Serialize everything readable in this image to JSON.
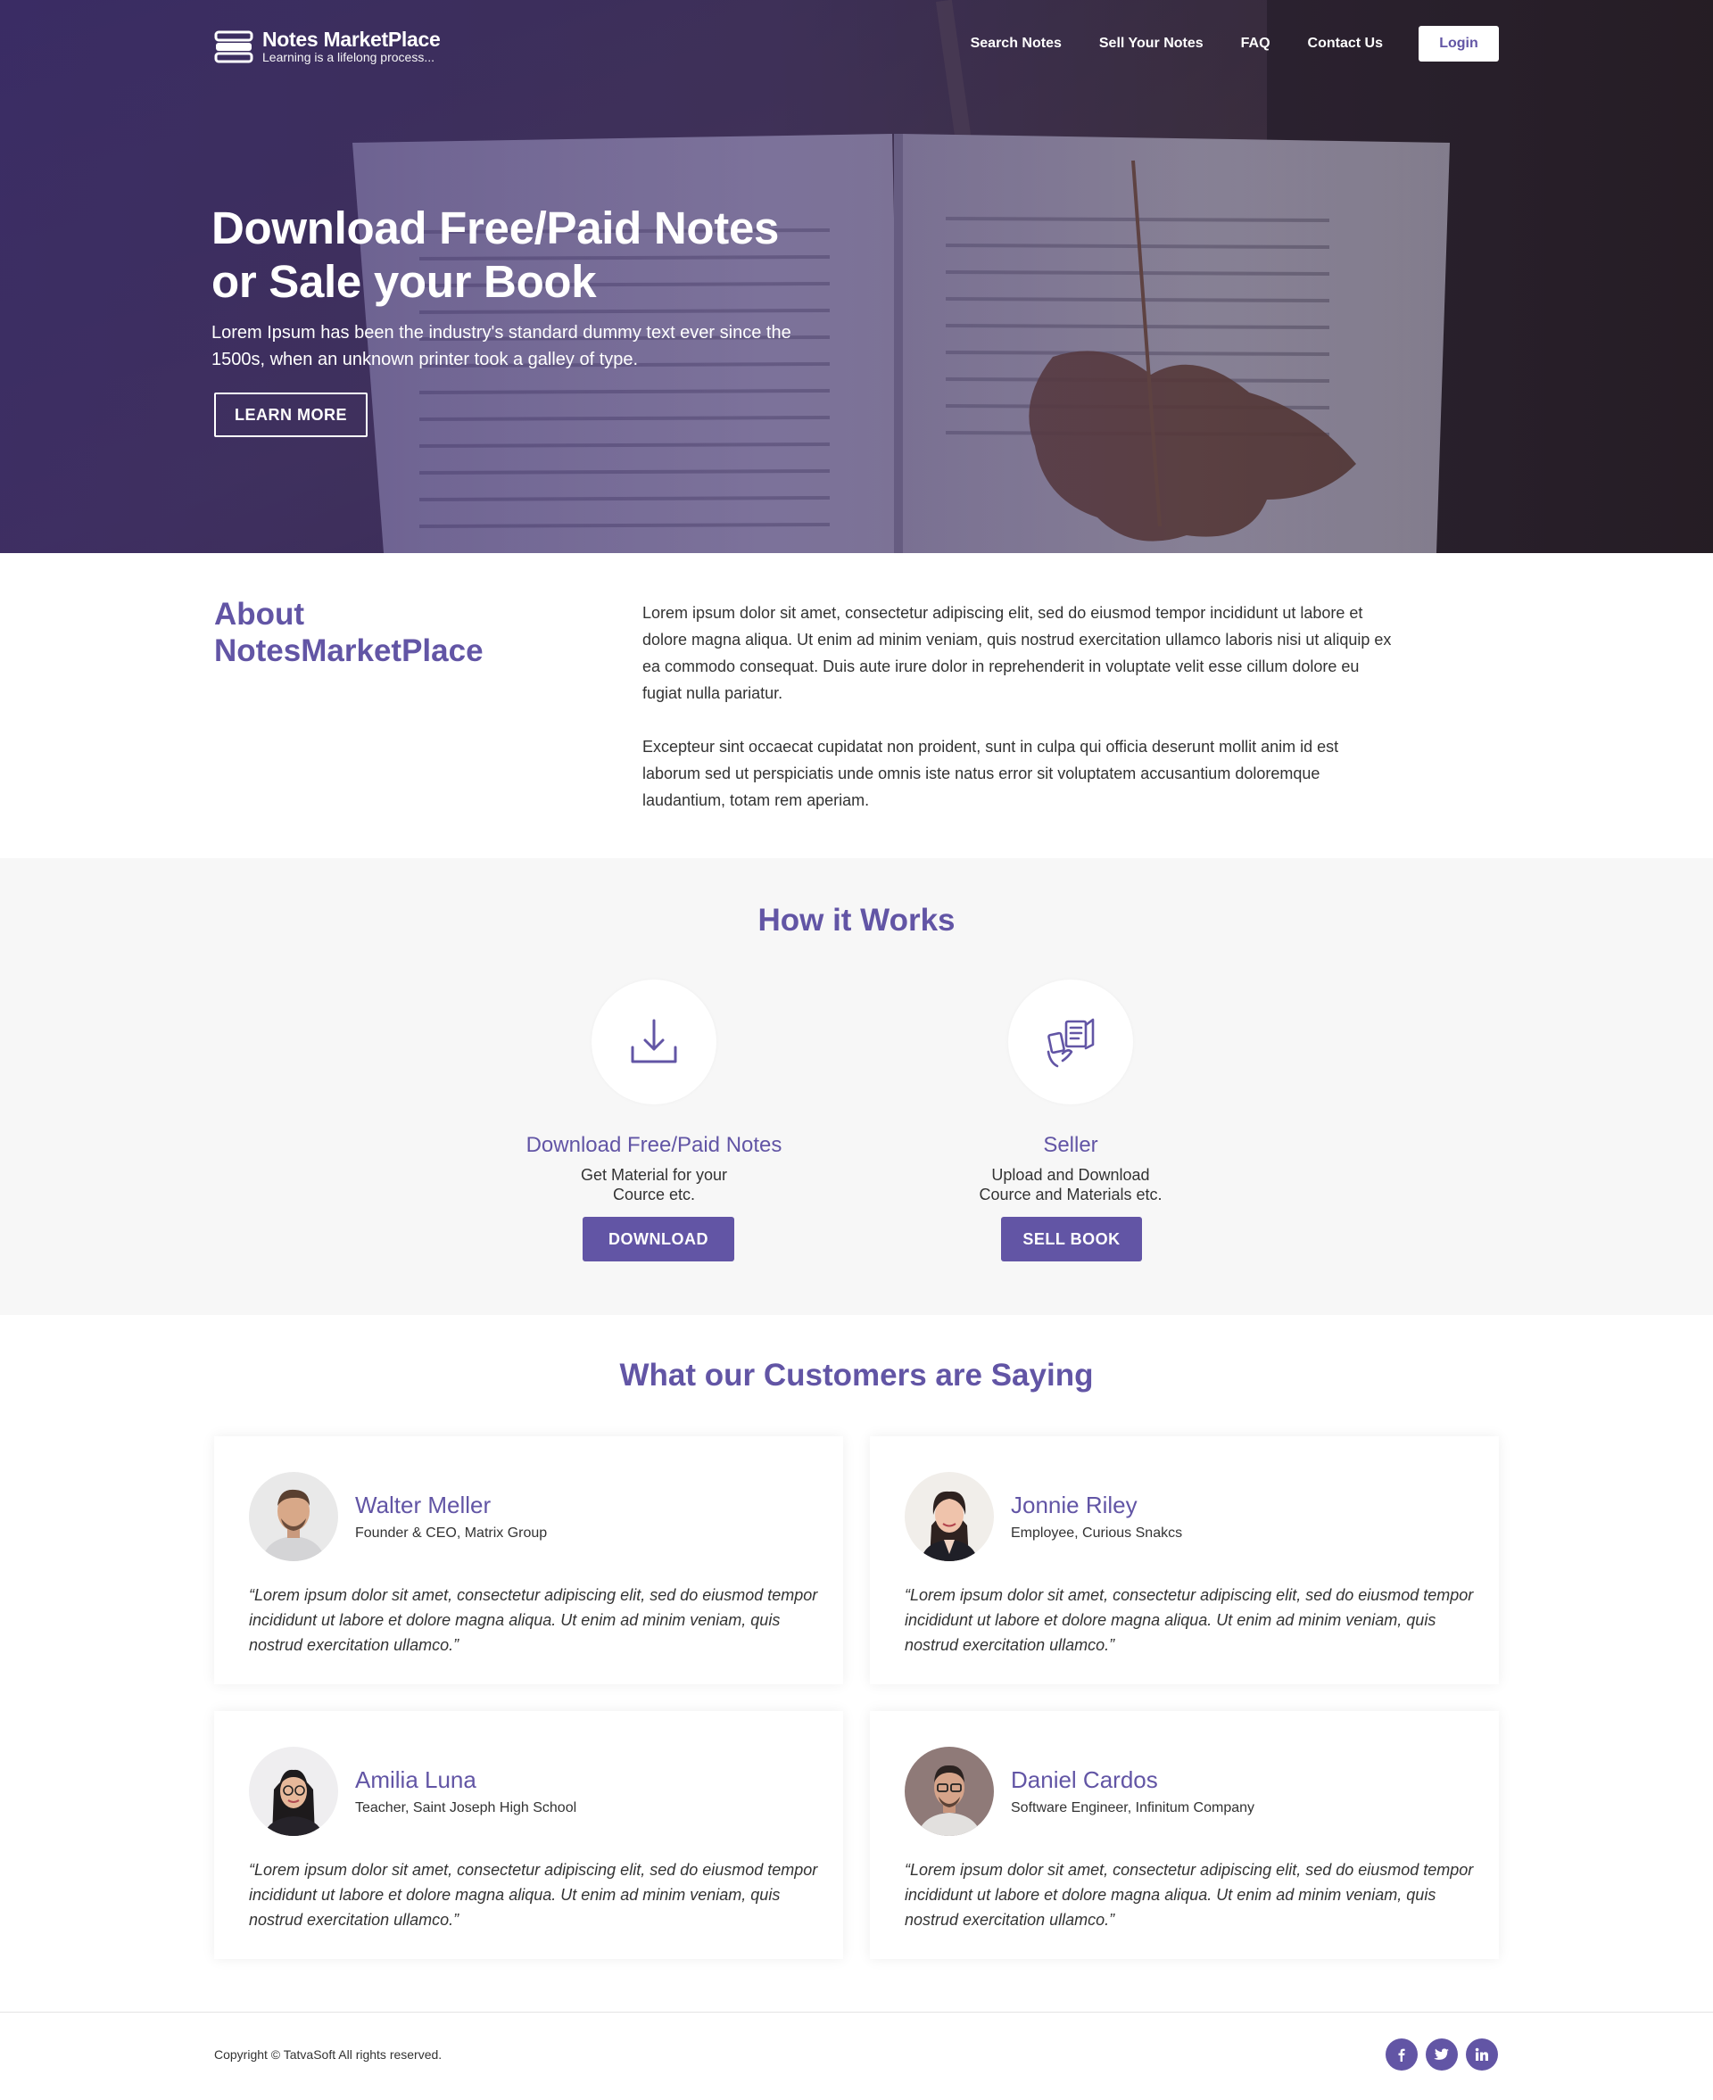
{
  "brand": {
    "name": "Notes MarketPlace",
    "tagline": "Learning is a lifelong process..."
  },
  "nav": {
    "links": [
      "Search Notes",
      "Sell Your Notes",
      "FAQ",
      "Contact Us"
    ],
    "login": "Login"
  },
  "hero": {
    "title_line1": "Download Free/Paid Notes",
    "title_line2": "or Sale your Book",
    "text": "Lorem Ipsum has been the industry's standard dummy text ever since the 1500s, when an unknown printer took a galley of type.",
    "button": "LEARN MORE"
  },
  "about": {
    "title_line1": "About",
    "title_line2": "NotesMarketPlace",
    "paragraph1": "Lorem ipsum dolor sit amet, consectetur adipiscing elit, sed do eiusmod tempor incididunt ut labore et dolore magna aliqua. Ut enim ad minim veniam, quis nostrud exercitation ullamco laboris nisi ut aliquip ex ea commodo consequat. Duis aute irure dolor in reprehenderit in voluptate velit esse cillum dolore eu fugiat nulla pariatur.",
    "paragraph2": "Excepteur sint occaecat cupidatat non proident, sunt in culpa qui officia deserunt mollit anim id est laborum sed ut perspiciatis unde omnis iste natus error sit voluptatem accusantium doloremque laudantium, totam rem aperiam."
  },
  "how": {
    "title": "How it Works",
    "steps": [
      {
        "icon": "download-icon",
        "title": "Download Free/Paid Notes",
        "desc": "Get Material for your Cource etc.",
        "button": "DOWNLOAD"
      },
      {
        "icon": "sell-book-icon",
        "title": "Seller",
        "desc": "Upload and Download Cource and Materials etc.",
        "button": "SELL BOOK"
      }
    ]
  },
  "testimonials": {
    "title": "What our Customers are Saying",
    "items": [
      {
        "name": "Walter Meller",
        "role": "Founder & CEO, Matrix Group",
        "quote": "“Lorem ipsum dolor sit amet, consectetur adipiscing elit, sed do eiusmod tempor incididunt ut labore et dolore magna aliqua. Ut enim ad minim veniam, quis nostrud exercitation ullamco.”"
      },
      {
        "name": "Jonnie Riley",
        "role": "Employee, Curious Snakcs",
        "quote": "“Lorem ipsum dolor sit amet, consectetur adipiscing elit, sed do eiusmod tempor incididunt ut labore et dolore magna aliqua. Ut enim ad minim veniam, quis nostrud exercitation ullamco.”"
      },
      {
        "name": "Amilia Luna",
        "role": "Teacher, Saint Joseph High School",
        "quote": "“Lorem ipsum dolor sit amet, consectetur adipiscing elit, sed do eiusmod tempor incididunt ut labore et dolore magna aliqua. Ut enim ad minim veniam, quis nostrud exercitation ullamco.”"
      },
      {
        "name": "Daniel Cardos",
        "role": "Software Engineer, Infinitum Company",
        "quote": "“Lorem ipsum dolor sit amet, consectetur adipiscing elit, sed do eiusmod tempor incididunt ut labore et dolore magna aliqua. Ut enim ad minim veniam, quis nostrud exercitation ullamco.”"
      }
    ]
  },
  "footer": {
    "copyright": "Copyright © TatvaSoft All rights reserved.",
    "socials": [
      "facebook-icon",
      "twitter-icon",
      "linkedin-icon"
    ]
  },
  "colors": {
    "accent": "#6255a5",
    "section_bg": "#f7f7f7"
  }
}
